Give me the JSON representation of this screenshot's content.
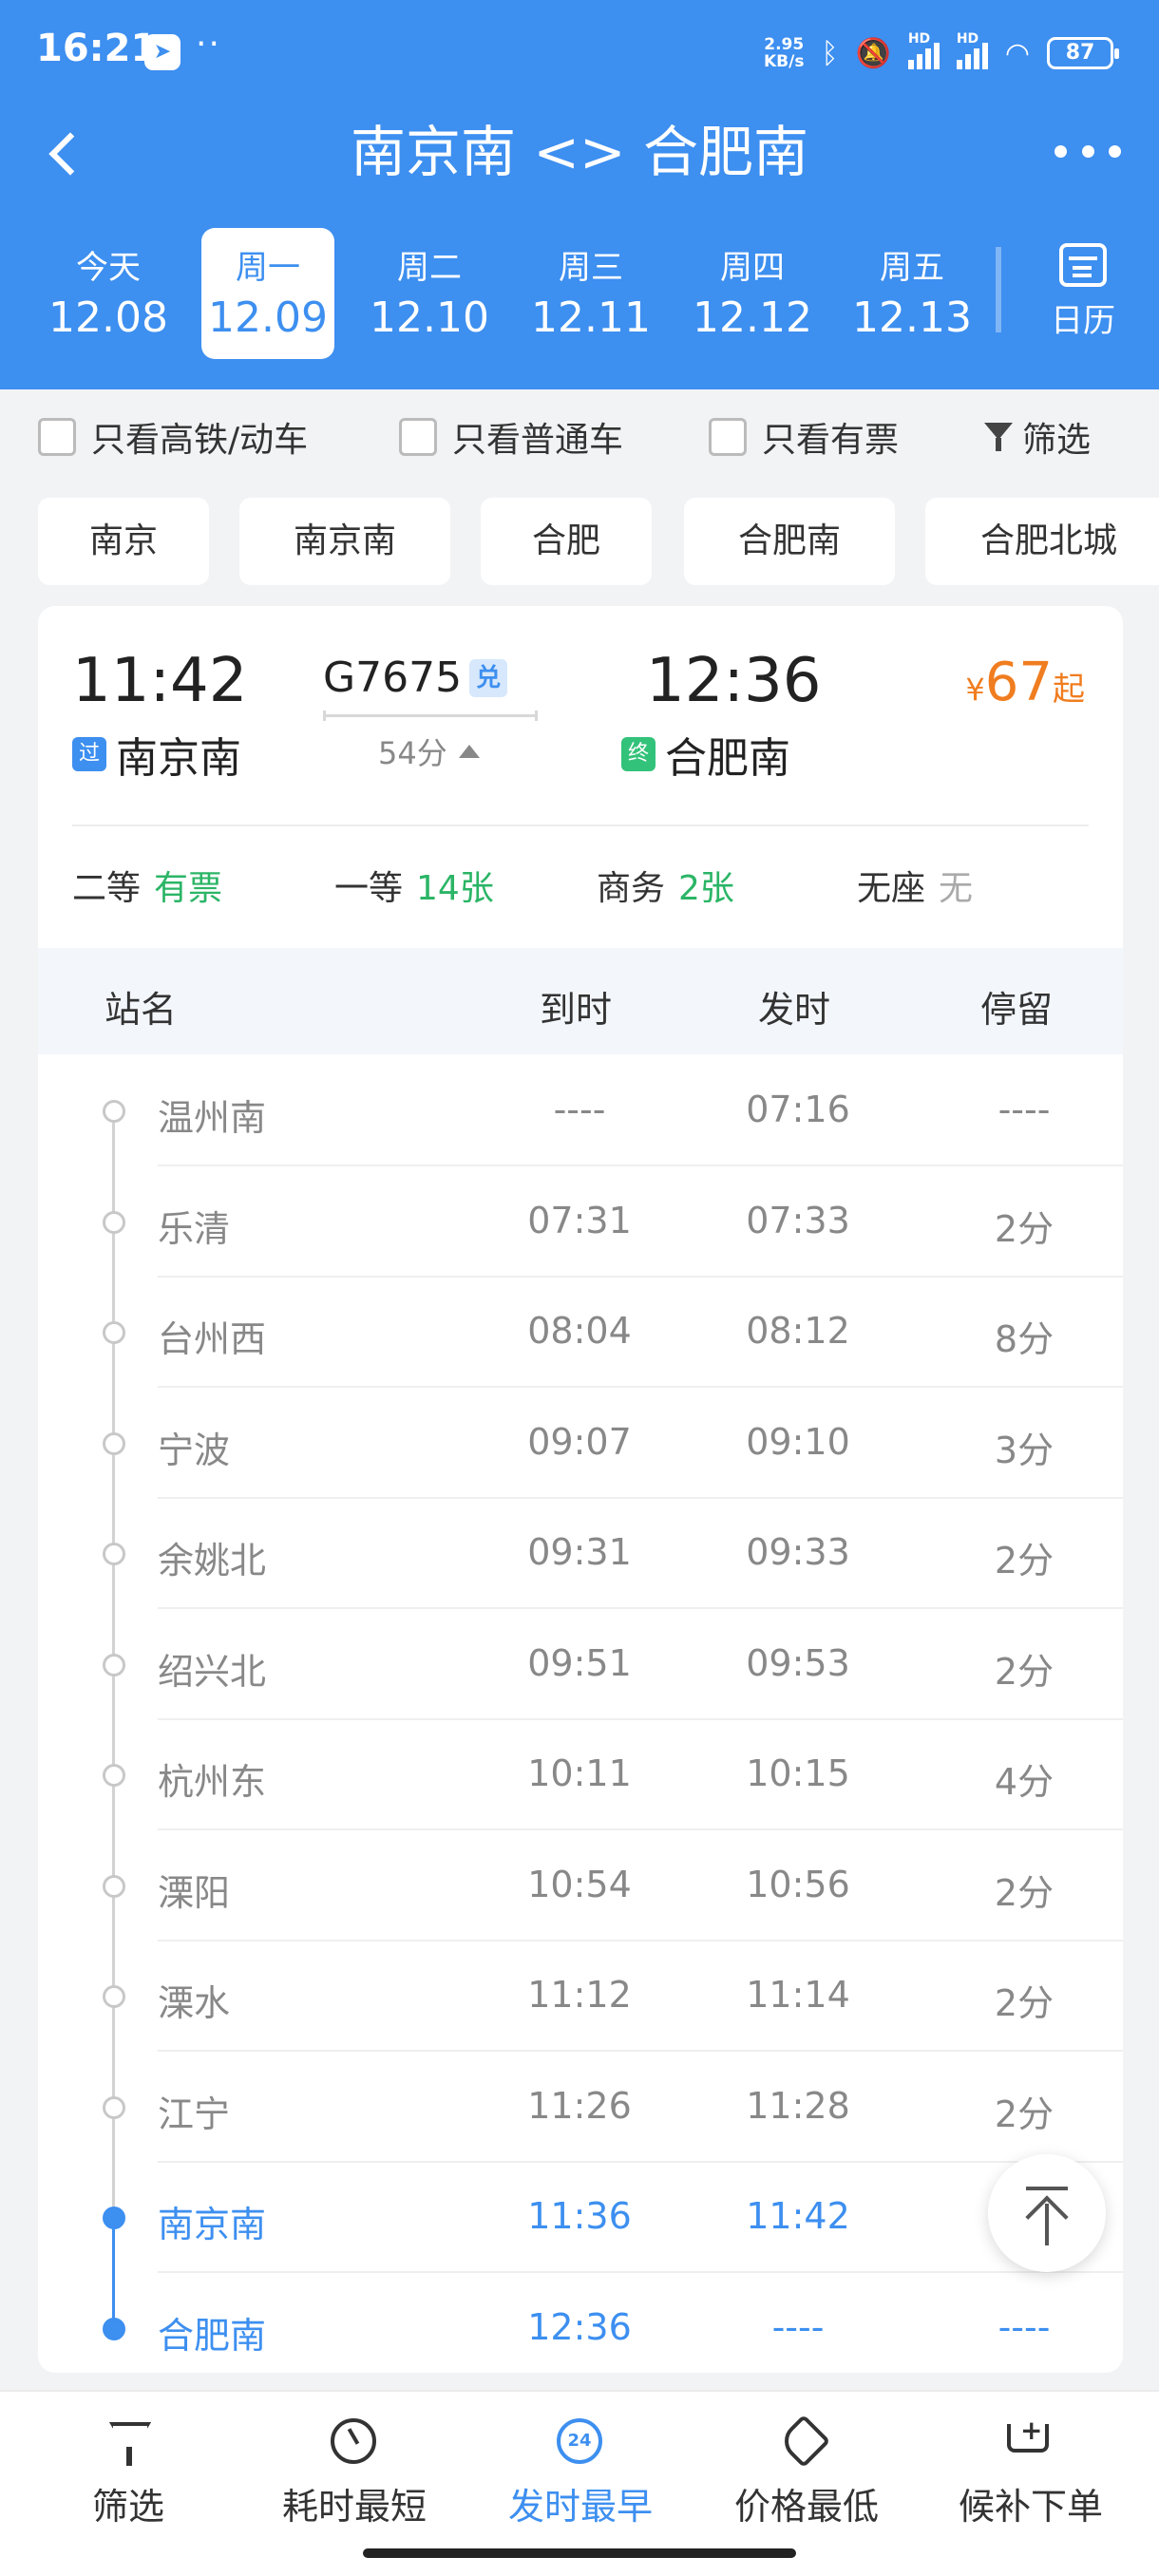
{
  "status_bar": {
    "time": "16:21",
    "net_speed_value": "2.95",
    "net_speed_unit": "KB/s",
    "signal_label_1": "HD",
    "signal_label_2": "HD",
    "battery": "87",
    "icons": [
      "telegram-icon",
      "bluetooth-icon",
      "mute-icon",
      "wifi-icon"
    ]
  },
  "header": {
    "title": "南京南 <> 合肥南",
    "accent_color": "#3d8ff0"
  },
  "dates": [
    {
      "weekday": "今天",
      "date": "12.08",
      "active": false
    },
    {
      "weekday": "周一",
      "date": "12.09",
      "active": true
    },
    {
      "weekday": "周二",
      "date": "12.10",
      "active": false
    },
    {
      "weekday": "周三",
      "date": "12.11",
      "active": false
    },
    {
      "weekday": "周四",
      "date": "12.12",
      "active": false
    },
    {
      "weekday": "周五",
      "date": "12.13",
      "active": false
    }
  ],
  "calendar_label": "日历",
  "filters": {
    "high_speed_only": "只看高铁/动车",
    "normal_only": "只看普通车",
    "available_only": "只看有票",
    "filter_label": "筛选"
  },
  "station_chips": [
    "南京",
    "南京南",
    "合肥",
    "合肥南",
    "合肥北城"
  ],
  "train": {
    "dep_time": "11:42",
    "dep_station": "南京南",
    "dep_tag": "过",
    "arr_time": "12:36",
    "arr_station": "合肥南",
    "arr_tag": "终",
    "train_no": "G7675",
    "exchange_badge": "兑",
    "duration": "54分",
    "price_currency": "¥",
    "price_value": "67",
    "price_suffix": "起",
    "seats": [
      {
        "class": "二等",
        "availability": "有票"
      },
      {
        "class": "一等",
        "availability": "14张"
      },
      {
        "class": "商务",
        "availability": "2张"
      },
      {
        "class": "无座",
        "availability": "无"
      }
    ]
  },
  "stops_header": {
    "name": "站名",
    "arrive": "到时",
    "depart": "发时",
    "stay": "停留"
  },
  "stops": [
    {
      "name": "温州南",
      "arrive": "----",
      "depart": "07:16",
      "stay": "----",
      "highlight": false
    },
    {
      "name": "乐清",
      "arrive": "07:31",
      "depart": "07:33",
      "stay": "2分",
      "highlight": false
    },
    {
      "name": "台州西",
      "arrive": "08:04",
      "depart": "08:12",
      "stay": "8分",
      "highlight": false
    },
    {
      "name": "宁波",
      "arrive": "09:07",
      "depart": "09:10",
      "stay": "3分",
      "highlight": false
    },
    {
      "name": "余姚北",
      "arrive": "09:31",
      "depart": "09:33",
      "stay": "2分",
      "highlight": false
    },
    {
      "name": "绍兴北",
      "arrive": "09:51",
      "depart": "09:53",
      "stay": "2分",
      "highlight": false
    },
    {
      "name": "杭州东",
      "arrive": "10:11",
      "depart": "10:15",
      "stay": "4分",
      "highlight": false
    },
    {
      "name": "溧阳",
      "arrive": "10:54",
      "depart": "10:56",
      "stay": "2分",
      "highlight": false
    },
    {
      "name": "溧水",
      "arrive": "11:12",
      "depart": "11:14",
      "stay": "2分",
      "highlight": false
    },
    {
      "name": "江宁",
      "arrive": "11:26",
      "depart": "11:28",
      "stay": "2分",
      "highlight": false
    },
    {
      "name": "南京南",
      "arrive": "11:36",
      "depart": "11:42",
      "stay": "",
      "highlight": true
    },
    {
      "name": "合肥南",
      "arrive": "12:36",
      "depart": "----",
      "stay": "----",
      "highlight": true
    }
  ],
  "bottom_tabs": [
    {
      "label": "筛选",
      "icon": "funnel-icon",
      "active": false
    },
    {
      "label": "耗时最短",
      "icon": "clock-icon",
      "active": false
    },
    {
      "label": "发时最早",
      "icon": "24h-icon",
      "icon_text": "24",
      "active": true
    },
    {
      "label": "价格最低",
      "icon": "price-tag-icon",
      "active": false
    },
    {
      "label": "候补下单",
      "icon": "cart-add-icon",
      "active": false
    }
  ]
}
